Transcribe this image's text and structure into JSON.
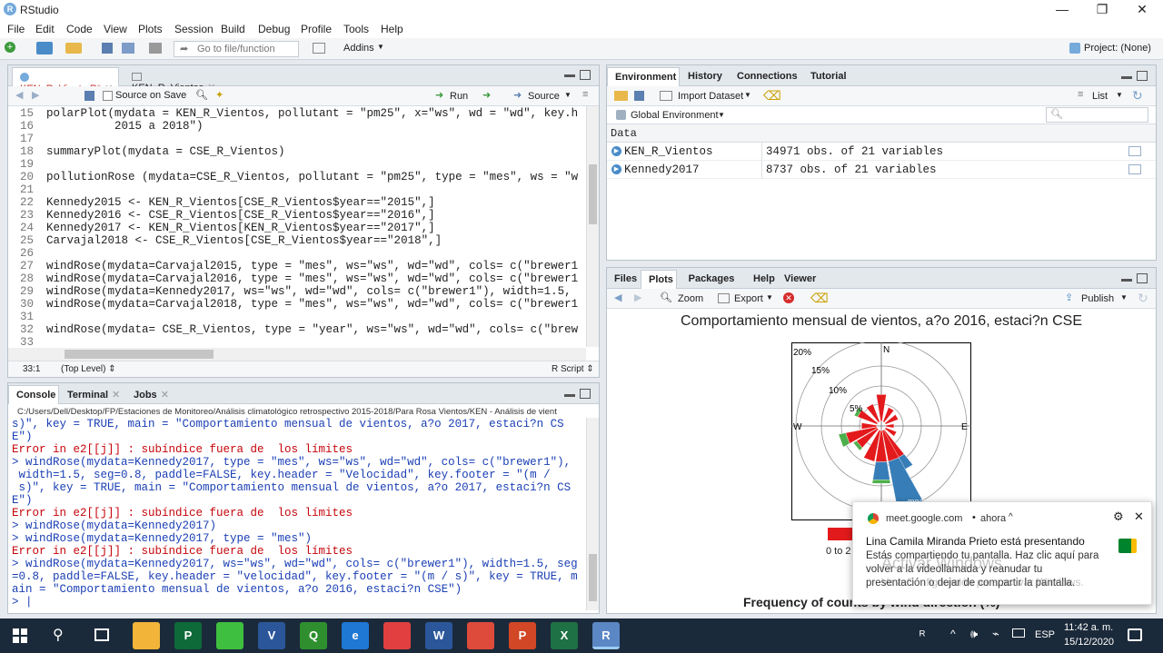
{
  "window": {
    "title": "RStudio",
    "minimize": "—",
    "maximize": "❐",
    "close": "✕"
  },
  "menu": [
    "File",
    "Edit",
    "Code",
    "View",
    "Plots",
    "Session",
    "Build",
    "Debug",
    "Profile",
    "Tools",
    "Help"
  ],
  "toolbar": {
    "goto_placeholder": "Go to file/function",
    "addins": "Addins",
    "project": "Project: (None)"
  },
  "editor": {
    "tabs": [
      {
        "label": "KEN_R_Viento.R*"
      },
      {
        "label": "KEN_R_Vientos"
      }
    ],
    "source_on_save": "Source on Save",
    "run": "Run",
    "source": "Source",
    "lines": [
      {
        "n": "15",
        "t": "polarPlot(mydata = KEN_R_Vientos, pollutant = \"pm25\", x=\"ws\", wd = \"wd\", key.h"
      },
      {
        "n": "16",
        "t": "          2015 a 2018\")"
      },
      {
        "n": "17",
        "t": ""
      },
      {
        "n": "18",
        "t": "summaryPlot(mydata = CSE_R_Vientos)"
      },
      {
        "n": "19",
        "t": ""
      },
      {
        "n": "20",
        "t": "pollutionRose (mydata=CSE_R_Vientos, pollutant = \"pm25\", type = \"mes\", ws = \"w"
      },
      {
        "n": "21",
        "t": ""
      },
      {
        "n": "22",
        "t": "Kennedy2015 <- KEN_R_Vientos[CSE_R_Vientos$year==\"2015\",]"
      },
      {
        "n": "23",
        "t": "Kennedy2016 <- CSE_R_Vientos[CSE_R_Vientos$year==\"2016\",]"
      },
      {
        "n": "24",
        "t": "Kennedy2017 <- KEN_R_Vientos[KEN_R_Vientos$year==\"2017\",]"
      },
      {
        "n": "25",
        "t": "Carvajal2018 <- CSE_R_Vientos[CSE_R_Vientos$year==\"2018\",]"
      },
      {
        "n": "26",
        "t": ""
      },
      {
        "n": "27",
        "t": "windRose(mydata=Carvajal2015, type = \"mes\", ws=\"ws\", wd=\"wd\", cols= c(\"brewer1"
      },
      {
        "n": "28",
        "t": "windRose(mydata=Carvajal2016, type = \"mes\", ws=\"ws\", wd=\"wd\", cols= c(\"brewer1"
      },
      {
        "n": "29",
        "t": "windRose(mydata=Kennedy2017, ws=\"ws\", wd=\"wd\", cols= c(\"brewer1\"), width=1.5,"
      },
      {
        "n": "30",
        "t": "windRose(mydata=Carvajal2018, type = \"mes\", ws=\"ws\", wd=\"wd\", cols= c(\"brewer1"
      },
      {
        "n": "31",
        "t": ""
      },
      {
        "n": "32",
        "t": "windRose(mydata= CSE_R_Vientos, type = \"year\", ws=\"ws\", wd=\"wd\", cols= c(\"brew"
      },
      {
        "n": "33",
        "t": ""
      },
      {
        "n": "34",
        "t": ""
      }
    ],
    "status_pos": "33:1",
    "status_scope": "(Top Level) ⇕",
    "status_type": "R Script ⇕"
  },
  "console": {
    "tabs": [
      "Console",
      "Terminal",
      "Jobs"
    ],
    "path": "C:/Users/Dell/Desktop/FP/Estaciones de Monitoreo/Análisis climatológico retrospectivo 2015-2018/Para Rosa Vientos/KEN - Análisis de vient",
    "lines": [
      {
        "t": "s)\", key = TRUE, main = \"Comportamiento mensual de vientos, a?o 2017, estaci?n CS",
        "c": "#1a3fb4"
      },
      {
        "t": "E\")",
        "c": "#1a3fb4"
      },
      {
        "t": "Error in e2[[j]] : subíndice fuera de  los límites",
        "c": "#c5060b"
      },
      {
        "t": "> windRose(mydata=Kennedy2017, type = \"mes\", ws=\"ws\", wd=\"wd\", cols= c(\"brewer1\"),",
        "c": "#1a3fb4"
      },
      {
        "t": " width=1.5, seg=0.8, paddle=FALSE, key.header = \"Velocidad\", key.footer = \"(m /",
        "c": "#1a3fb4"
      },
      {
        "t": " s)\", key = TRUE, main = \"Comportamiento mensual de vientos, a?o 2017, estaci?n CS",
        "c": "#1a3fb4"
      },
      {
        "t": "E\")",
        "c": "#1a3fb4"
      },
      {
        "t": "Error in e2[[j]] : subíndice fuera de  los límites",
        "c": "#c5060b"
      },
      {
        "t": "> windRose(mydata=Kennedy2017)",
        "c": "#1a3fb4"
      },
      {
        "t": "> windRose(mydata=Kennedy2017, type = \"mes\")",
        "c": "#1a3fb4"
      },
      {
        "t": "Error in e2[[j]] : subíndice fuera de  los límites",
        "c": "#c5060b"
      },
      {
        "t": "> windRose(mydata=Kennedy2017, ws=\"ws\", wd=\"wd\", cols= c(\"brewer1\"), width=1.5, seg",
        "c": "#1a3fb4"
      },
      {
        "t": "=0.8, paddle=FALSE, key.header = \"velocidad\", key.footer = \"(m / s)\", key = TRUE, m",
        "c": "#1a3fb4"
      },
      {
        "t": "ain = \"Comportamiento mensual de vientos, a?o 2016, estaci?n CSE\")",
        "c": "#1a3fb4"
      },
      {
        "t": "> |",
        "c": "#1a3fb4"
      }
    ]
  },
  "environment": {
    "tabs": [
      "Environment",
      "History",
      "Connections",
      "Tutorial"
    ],
    "import": "Import Dataset",
    "list": "List",
    "global": "Global Environment",
    "data_header": "Data",
    "rows": [
      {
        "name": "KEN_R_Vientos",
        "value": "34971 obs. of 21 variables"
      },
      {
        "name": "Kennedy2017",
        "value": "8737 obs. of 21 variables"
      }
    ]
  },
  "plots": {
    "tabs": [
      "Files",
      "Plots",
      "Packages",
      "Help",
      "Viewer"
    ],
    "zoom": "Zoom",
    "export": "Export",
    "publish": "Publish",
    "title": "Comportamiento mensual de vientos, a?o 2016, estaci?n CSE",
    "pct": [
      "20%",
      "15%",
      "10%",
      "5%"
    ],
    "dirs": [
      "N",
      "W",
      "E"
    ],
    "legend_label": "0 to 2",
    "calm": "mean = 2.2889",
    "footer": "Frequency of counts by wind direction (%)"
  },
  "notification": {
    "source": "meet.google.com",
    "time": "ahora",
    "title": "Lina Camila Miranda Prieto está presentando",
    "body": "Estás compartiendo tu pantalla. Haz clic aquí para volver a la videollamada y reanudar tu presentación o dejar de compartir la pantalla.",
    "watermark1": "Activar Windows",
    "watermark2": "Ve a Configuración para activar Windows."
  },
  "taskbar": {
    "lang": "ESP",
    "time": "11:42 a. m.",
    "date": "15/12/2020",
    "apps": [
      {
        "label": "",
        "color": "#f2b53a"
      },
      {
        "label": "P",
        "color": "#0f6a3a"
      },
      {
        "label": "",
        "color": "#3fbf3f"
      },
      {
        "label": "V",
        "color": "#2b579a"
      },
      {
        "label": "Q",
        "color": "#2f8f2f"
      },
      {
        "label": "e",
        "color": "#1e78d4"
      },
      {
        "label": "",
        "color": "#e24040"
      },
      {
        "label": "W",
        "color": "#2b579a"
      },
      {
        "label": "",
        "color": "#de4b3b"
      },
      {
        "label": "P",
        "color": "#d24726"
      },
      {
        "label": "X",
        "color": "#1e7145"
      },
      {
        "label": "R",
        "color": "#5b87c4"
      }
    ]
  }
}
